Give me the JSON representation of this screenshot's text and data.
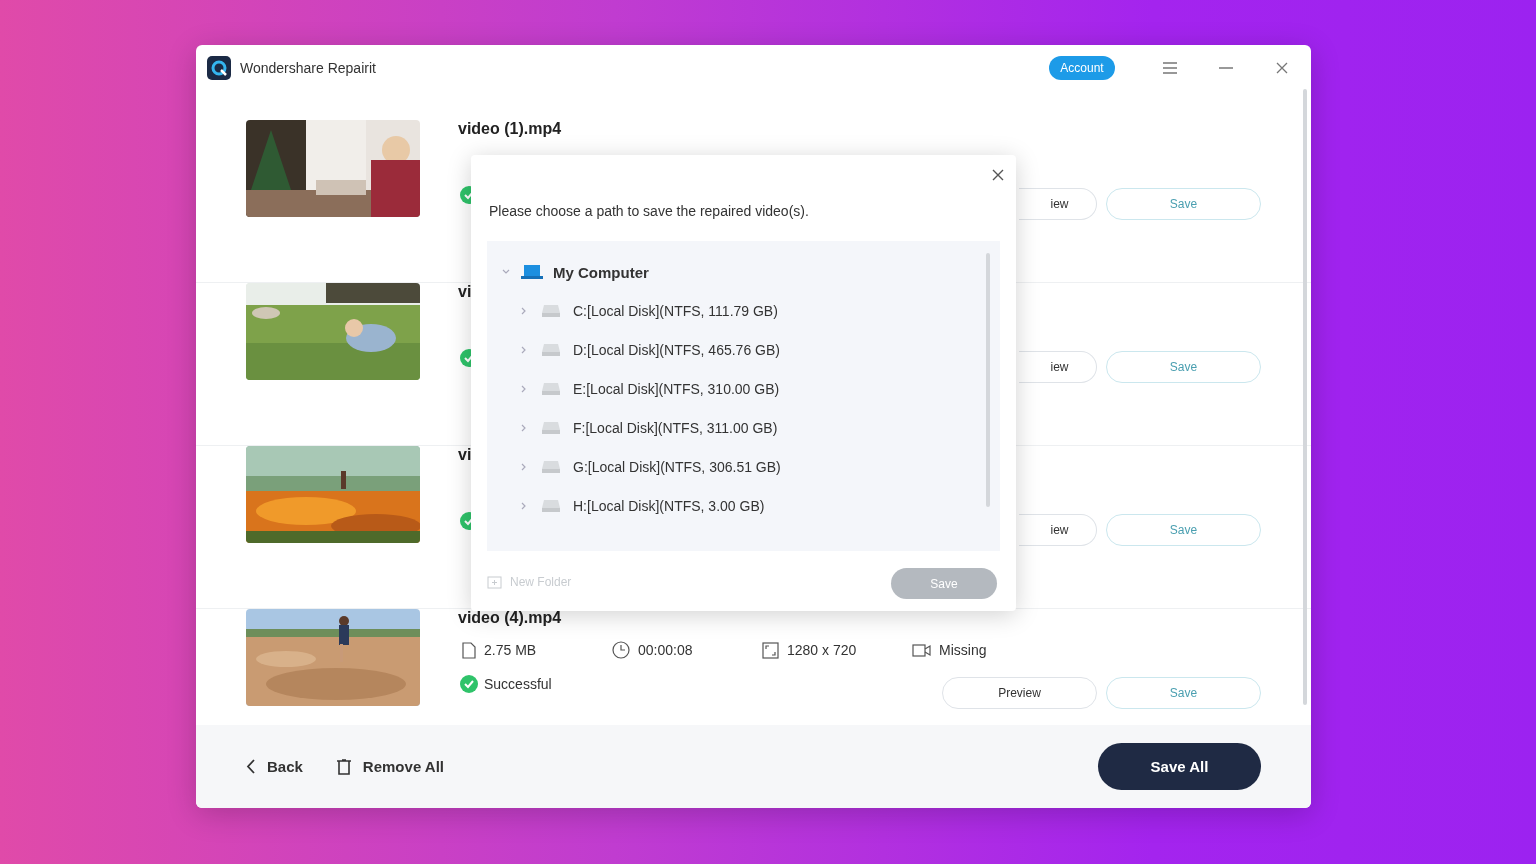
{
  "window": {
    "title": "Wondershare Repairit",
    "account_button": "Account"
  },
  "videos": [
    {
      "name": "video (1).mp4",
      "status": {
        "kind": "success"
      },
      "buttons": [
        {
          "kind": "preview",
          "label": "iew"
        },
        {
          "kind": "save",
          "label": "Save"
        }
      ]
    },
    {
      "name": "vi",
      "status": {
        "kind": "success"
      },
      "buttons": [
        {
          "kind": "preview",
          "label": "iew"
        },
        {
          "kind": "save",
          "label": "Save"
        }
      ]
    },
    {
      "name": "vi",
      "status": {
        "kind": "success"
      },
      "buttons": [
        {
          "kind": "preview",
          "label": "iew"
        },
        {
          "kind": "save",
          "label": "Save"
        }
      ]
    },
    {
      "name": "video (4).mp4",
      "meta": [
        {
          "kind": "size",
          "text": "2.75  MB"
        },
        {
          "kind": "duration",
          "text": "00:00:08"
        },
        {
          "kind": "resolution",
          "text": "1280 x 720"
        },
        {
          "kind": "audio",
          "text": "Missing"
        }
      ],
      "status": {
        "kind": "success",
        "text": "Successful"
      },
      "buttons": [
        {
          "kind": "preview",
          "label": "Preview"
        },
        {
          "kind": "save",
          "label": "Save"
        }
      ]
    }
  ],
  "bottom_bar": {
    "back": "Back",
    "remove_all": "Remove All",
    "save_all": "Save All"
  },
  "dialog": {
    "message": "Please choose a path to save the repaired video(s).",
    "tree": {
      "label": "My Computer",
      "expanded": true,
      "children": [
        {
          "label": "C:[Local Disk](NTFS, 111.79  GB)",
          "expanded": false
        },
        {
          "label": "D:[Local Disk](NTFS, 465.76  GB)",
          "expanded": false
        },
        {
          "label": "E:[Local Disk](NTFS, 310.00  GB)",
          "expanded": false
        },
        {
          "label": "F:[Local Disk](NTFS, 311.00  GB)",
          "expanded": false
        },
        {
          "label": "G:[Local Disk](NTFS, 306.51  GB)",
          "expanded": false
        },
        {
          "label": "H:[Local Disk](NTFS, 3.00  GB)",
          "expanded": false
        }
      ]
    },
    "new_folder": {
      "label": "New Folder",
      "disabled": true
    },
    "save": {
      "label": "Save",
      "disabled": true
    }
  }
}
